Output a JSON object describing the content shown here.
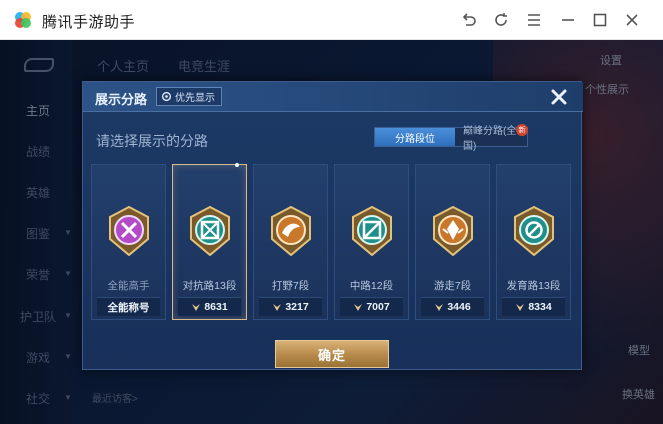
{
  "window": {
    "title": "腾讯手游助手"
  },
  "game_bg": {
    "nav_items": [
      "主页",
      "战绩",
      "英雄",
      "图鉴",
      "荣誉",
      "护卫队",
      "游戏",
      "社交"
    ],
    "tabs": [
      "个人主页",
      "电竞生涯"
    ],
    "settings_label": "设置",
    "display_label": "个性展示",
    "model_label": "模型",
    "swap_label": "换英雄",
    "recent_label": "最近访客>"
  },
  "modal": {
    "title": "展示分路",
    "priority_label": "优先显示",
    "subtitle": "请选择展示的分路",
    "toggle_options": [
      "分路段位",
      "巅峰分路(全国)"
    ],
    "toggle_active": 0,
    "new_badge": "新",
    "confirm_label": "确定",
    "accent_color": "#d9b98a",
    "lanes": [
      {
        "name": "全能高手",
        "footer": "全能称号",
        "icon": "allround-emblem-icon",
        "selected": false
      },
      {
        "name": "对抗路13段",
        "score": "8631",
        "icon": "clash-lane-emblem-icon",
        "selected": true
      },
      {
        "name": "打野7段",
        "score": "3217",
        "icon": "jungle-emblem-icon",
        "selected": false
      },
      {
        "name": "中路12段",
        "score": "7007",
        "icon": "mid-lane-emblem-icon",
        "selected": false
      },
      {
        "name": "游走7段",
        "score": "3446",
        "icon": "roam-emblem-icon",
        "selected": false
      },
      {
        "name": "发育路13段",
        "score": "8334",
        "icon": "farm-lane-emblem-icon",
        "selected": false
      }
    ]
  }
}
